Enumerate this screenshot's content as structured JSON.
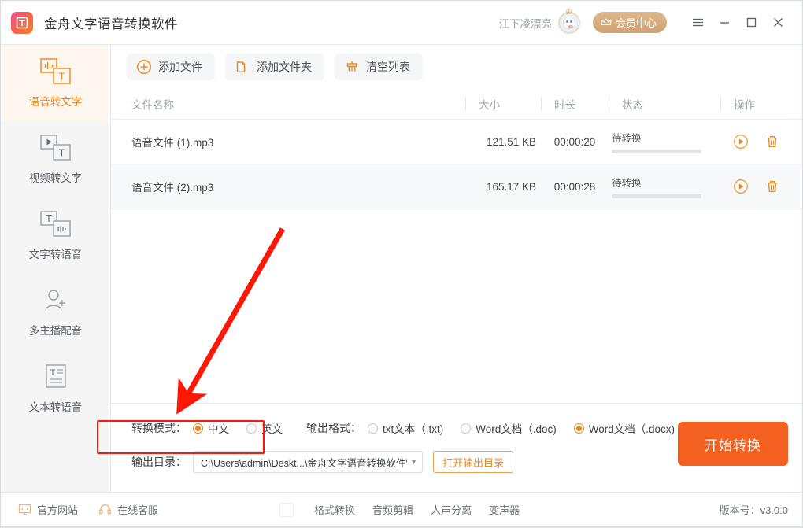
{
  "titlebar": {
    "app_title": "金舟文字语音转换软件",
    "username": "江下凌漂亮",
    "vip_label": "会员中心",
    "menu_icon": "hamburger-icon",
    "minimize_icon": "minimize-icon",
    "maximize_icon": "maximize-icon",
    "close_icon": "close-icon",
    "logo_icon": "app-logo-icon",
    "avatar_icon": "user-avatar-icon",
    "crown_icon": "crown-icon"
  },
  "sidebar": {
    "items": [
      {
        "label": "语音转文字",
        "icon": "audio-to-text-icon",
        "active": true
      },
      {
        "label": "视频转文字",
        "icon": "video-to-text-icon",
        "active": false
      },
      {
        "label": "文字转语音",
        "icon": "text-to-audio-icon",
        "active": false
      },
      {
        "label": "多主播配音",
        "icon": "multi-speaker-icon",
        "active": false
      },
      {
        "label": "文本转语音",
        "icon": "text-file-to-speech-icon",
        "active": false
      }
    ]
  },
  "toolbar": {
    "add_file": "添加文件",
    "add_folder": "添加文件夹",
    "clear_list": "清空列表",
    "add_file_icon": "plus-circle-icon",
    "add_folder_icon": "folder-icon",
    "clear_list_icon": "broom-icon"
  },
  "table": {
    "headers": {
      "name": "文件名称",
      "size": "大小",
      "duration": "时长",
      "status": "状态",
      "action": "操作"
    },
    "rows": [
      {
        "name": "语音文件 (1).mp3",
        "size": "121.51 KB",
        "duration": "00:00:20",
        "status": "待转换",
        "progress": 0,
        "play_icon": "play-circle-icon",
        "delete_icon": "trash-icon"
      },
      {
        "name": "语音文件 (2).mp3",
        "size": "165.17 KB",
        "duration": "00:00:28",
        "status": "待转换",
        "progress": 0,
        "play_icon": "play-circle-icon",
        "delete_icon": "trash-icon"
      }
    ]
  },
  "settings": {
    "mode_label": "转换模式：",
    "mode_options": [
      {
        "label": "中文",
        "selected": true
      },
      {
        "label": "英文",
        "selected": false
      }
    ],
    "format_label": "输出格式：",
    "format_options": [
      {
        "label": "txt文本（.txt)",
        "selected": false
      },
      {
        "label": "Word文档（.doc)",
        "selected": false
      },
      {
        "label": "Word文档（.docx)",
        "selected": true
      }
    ],
    "dir_label": "输出目录：",
    "dir_value": "C:\\Users\\admin\\Deskt...\\金舟文字语音转换软件\\",
    "open_dir_label": "打开输出目录",
    "start_label": "开始转换"
  },
  "footer": {
    "website": "官方网站",
    "support": "在线客服",
    "website_icon": "monitor-icon",
    "support_icon": "headset-icon",
    "tools": [
      "格式转换",
      "音频剪辑",
      "人声分离",
      "变声器"
    ],
    "version": "版本号：v3.0.0"
  },
  "annotation": {
    "arrow_color": "#fc1706",
    "highlight_color": "#fc1706"
  },
  "colors": {
    "accent": "#f08519",
    "start_button": "#f4601f",
    "active_bg": "#fdf7ef"
  }
}
